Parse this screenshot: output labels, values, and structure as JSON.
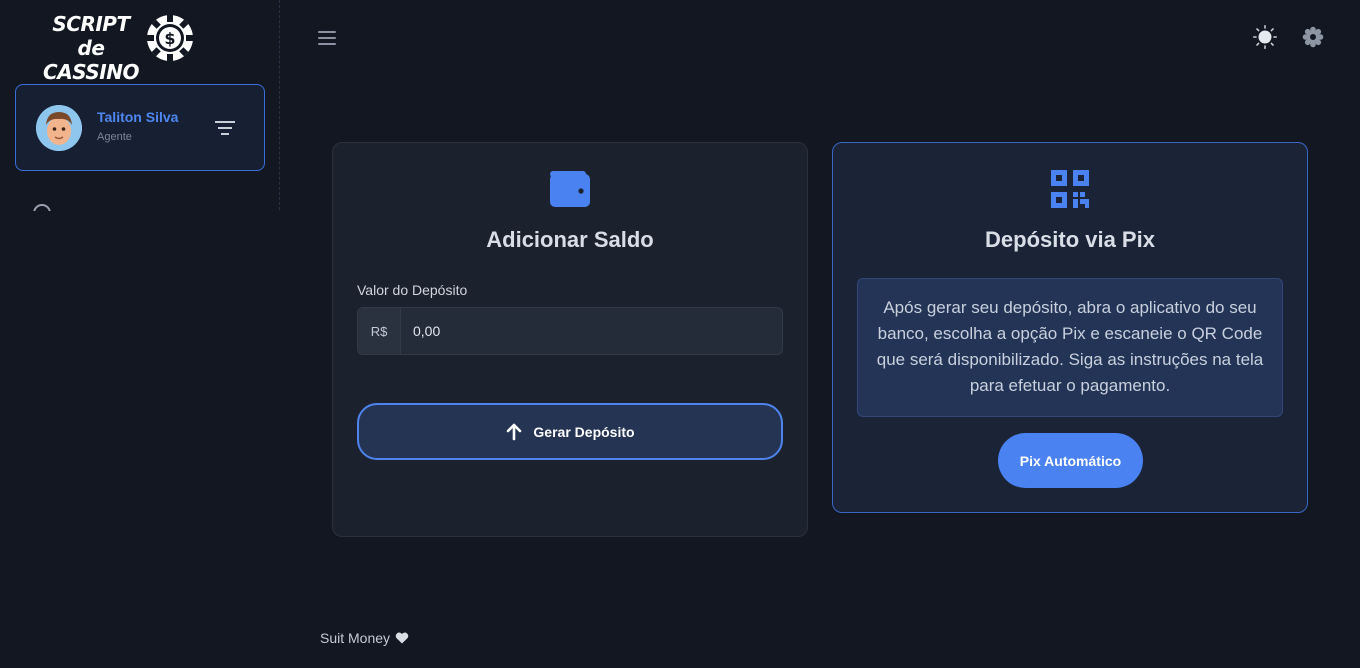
{
  "brand": {
    "logo_line1": "SCRIPT de",
    "logo_line2": "CASSINO"
  },
  "user": {
    "name": "Taliton Silva",
    "role": "Agente"
  },
  "deposit_card": {
    "title": "Adicionar Saldo",
    "field_label": "Valor do Depósito",
    "currency_prefix": "R$",
    "amount_value": "0,00",
    "button_label": "Gerar Depósito"
  },
  "pix_card": {
    "title": "Depósito via Pix",
    "instructions": "Após gerar seu depósito, abra o aplicativo do seu banco, escolha a opção Pix e escaneie o QR Code que será disponibilizado. Siga as instruções na tela para efetuar o pagamento.",
    "button_label": "Pix Automático"
  },
  "footer": {
    "text": "Suit Money"
  },
  "icons": {
    "menu": "hamburger-menu-icon",
    "theme": "sun-icon",
    "settings": "gear-icon",
    "wallet": "wallet-icon",
    "qr": "qr-code-icon",
    "upload": "arrow-up-icon",
    "heart": "heart-icon",
    "filter": "filter-icon"
  },
  "colors": {
    "accent": "#4a82f2",
    "background": "#121722",
    "card": "#1b212d"
  }
}
